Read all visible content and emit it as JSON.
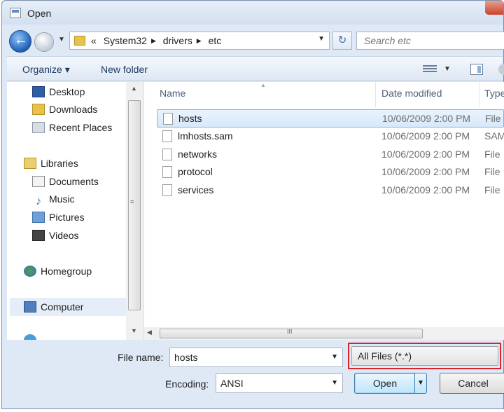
{
  "window": {
    "title": "Open"
  },
  "address": {
    "overflow": "«",
    "crumbs": [
      "System32",
      "drivers",
      "etc"
    ],
    "search_placeholder": "Search etc"
  },
  "toolbar": {
    "organize": "Organize ▾",
    "new_folder": "New folder"
  },
  "nav": {
    "favorites": [
      "Desktop",
      "Downloads",
      "Recent Places"
    ],
    "libraries": "Libraries",
    "library_items": [
      "Documents",
      "Music",
      "Pictures",
      "Videos"
    ],
    "homegroup": "Homegroup",
    "computer": "Computer"
  },
  "columns": {
    "name": "Name",
    "date": "Date modified",
    "type": "Type"
  },
  "files": [
    {
      "name": "hosts",
      "date": "10/06/2009 2:00 PM",
      "type": "File"
    },
    {
      "name": "lmhosts.sam",
      "date": "10/06/2009 2:00 PM",
      "type": "SAM"
    },
    {
      "name": "networks",
      "date": "10/06/2009 2:00 PM",
      "type": "File"
    },
    {
      "name": "protocol",
      "date": "10/06/2009 2:00 PM",
      "type": "File"
    },
    {
      "name": "services",
      "date": "10/06/2009 2:00 PM",
      "type": "File"
    }
  ],
  "bottom": {
    "filename_label": "File name:",
    "filename_value": "hosts",
    "filter_value": "All Files  (*.*)",
    "encoding_label": "Encoding:",
    "encoding_value": "ANSI",
    "open_button": "Open",
    "cancel_button": "Cancel"
  },
  "colors": {
    "highlight_box": "#d9232a",
    "selection": "#d6e8fa"
  }
}
